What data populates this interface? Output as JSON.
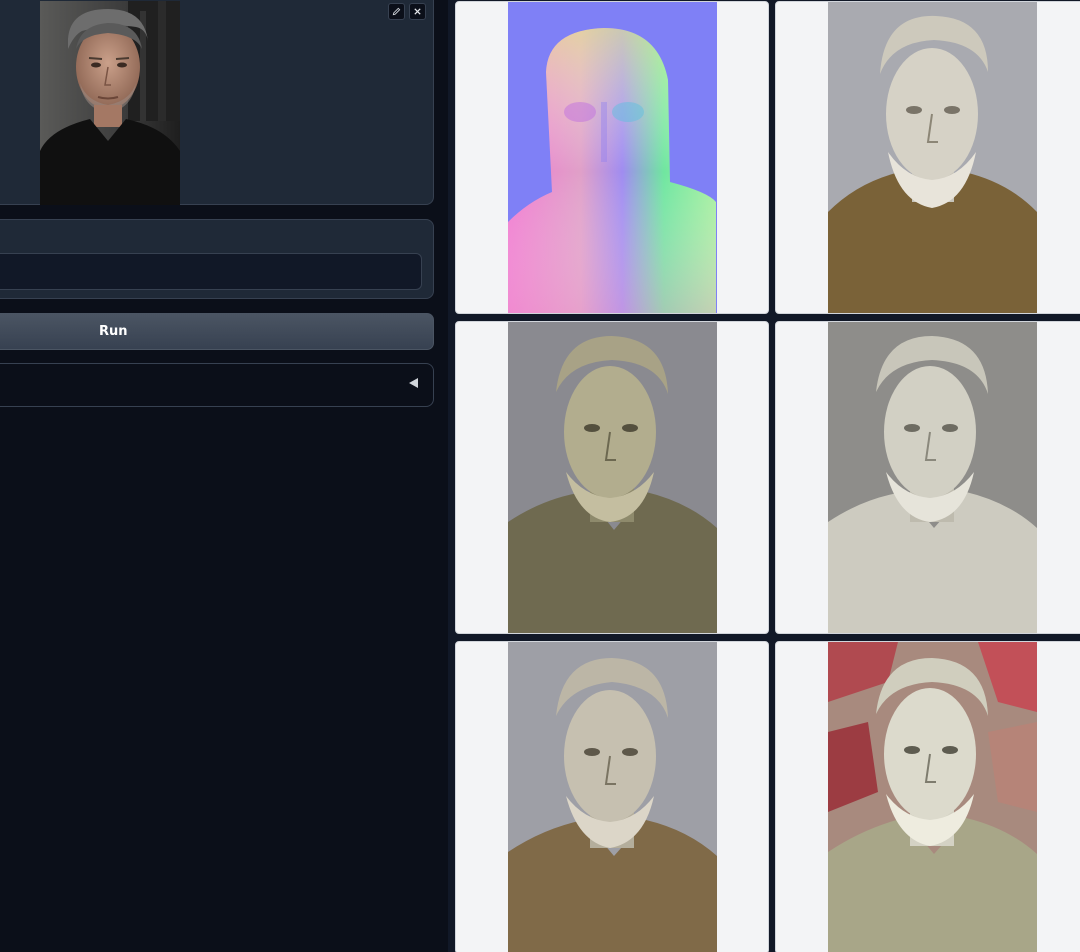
{
  "toolbar": {
    "edit_icon": "pencil-icon",
    "close_icon": "close-icon"
  },
  "input_image": {
    "subject": "man-portrait"
  },
  "text_field": {
    "value": "",
    "placeholder": ""
  },
  "run_button": {
    "label": "Run"
  },
  "accordion": {
    "icon": "triangle-left-icon"
  },
  "gallery": {
    "items": [
      {
        "kind": "normal-map"
      },
      {
        "kind": "bust-brown"
      },
      {
        "kind": "bust-olive"
      },
      {
        "kind": "bust-white"
      },
      {
        "kind": "bust-brown-2"
      },
      {
        "kind": "bust-red-stone"
      }
    ]
  },
  "colors": {
    "background": "#0b0f19",
    "panel": "#1f2937",
    "border": "#374151",
    "button": "#4b5563",
    "text": "#ffffff"
  }
}
